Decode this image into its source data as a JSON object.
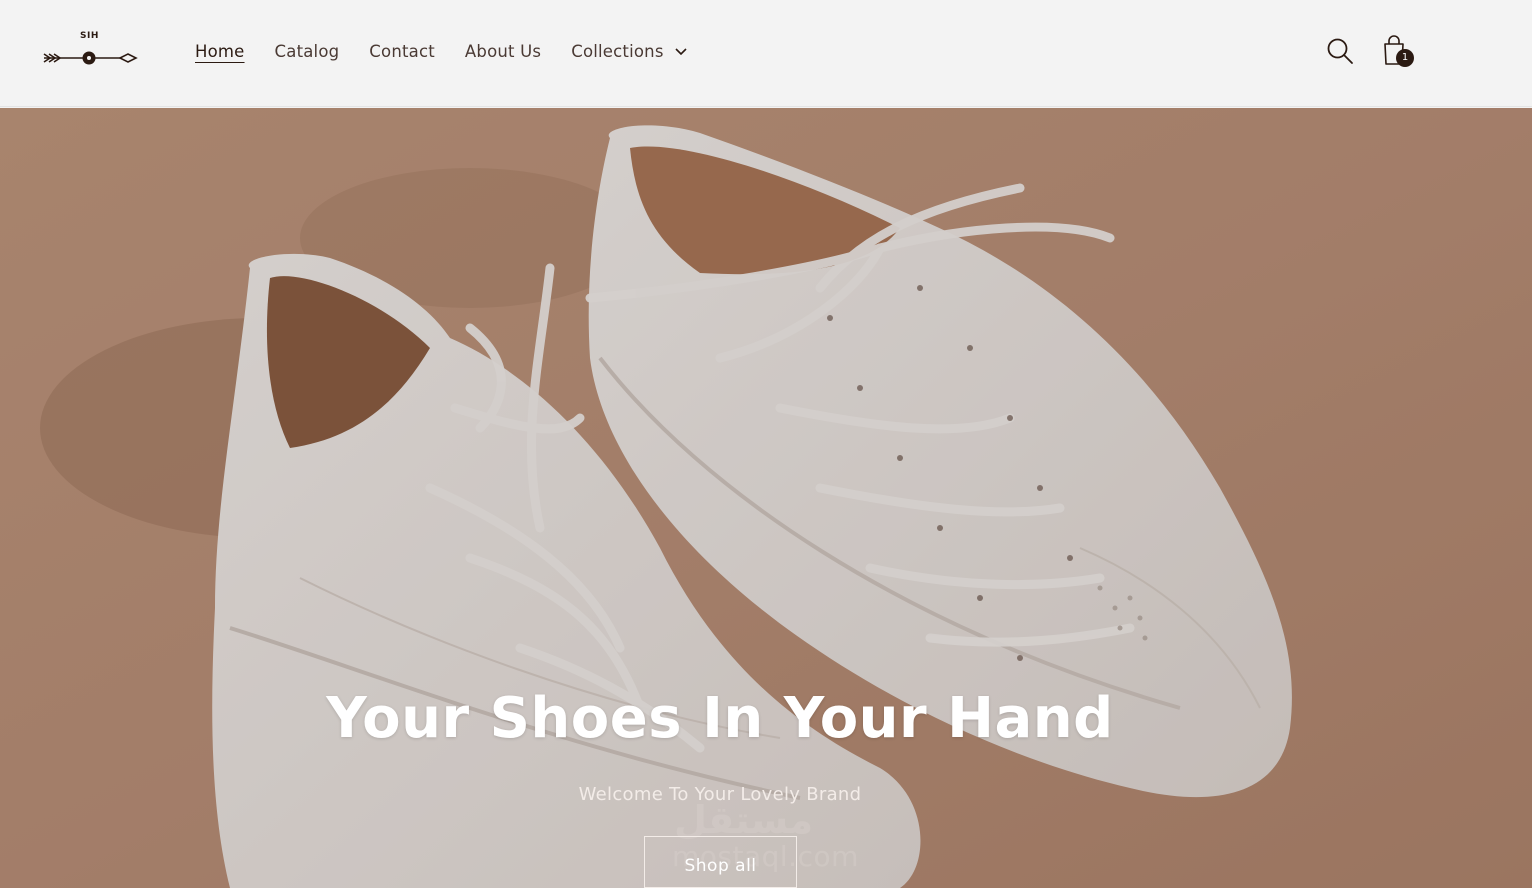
{
  "brand": {
    "logo_text": "SIH",
    "logo_icon": "arrow-logo-icon"
  },
  "nav": {
    "items": [
      {
        "label": "Home",
        "active": true
      },
      {
        "label": "Catalog",
        "active": false
      },
      {
        "label": "Contact",
        "active": false
      },
      {
        "label": "About Us",
        "active": false
      }
    ],
    "collections_label": "Collections",
    "collections_icon": "chevron-down-icon"
  },
  "header_actions": {
    "search_icon": "search-icon",
    "cart_icon": "shopping-bag-icon",
    "cart_count": "1"
  },
  "hero": {
    "title": "Your Shoes In Your Hand",
    "subtitle": "Welcome To Your Lovely Brand",
    "button_label": "Shop all",
    "image": "white-sneakers-photo"
  },
  "watermark": {
    "arabic": "مستقل",
    "latin": "mostaql.com"
  },
  "colors": {
    "header_bg": "#f3f3f3",
    "text_dark": "#2b1a12",
    "nav_text": "#4a3a34",
    "hero_bg": "#b7917c",
    "hero_text": "#ffffff"
  }
}
